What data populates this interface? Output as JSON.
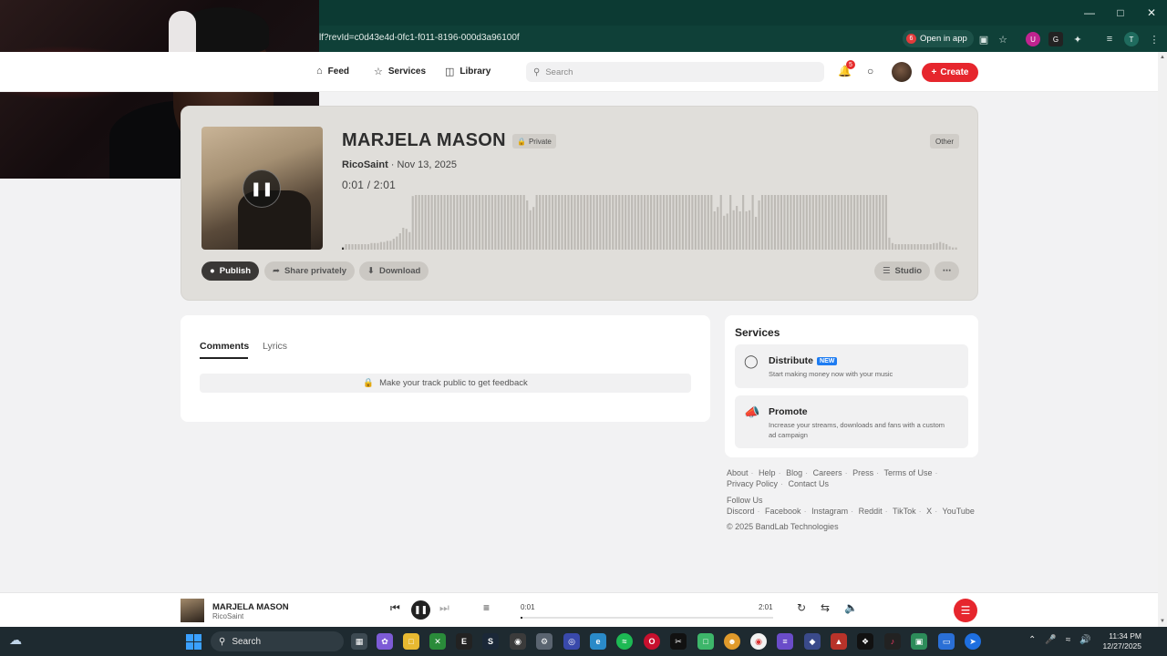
{
  "browser": {
    "url": "lf?revId=c0d43e4d-0fc1-f011-8196-000d3a96100f",
    "open_in_app_label": "Open in app",
    "open_in_app_badge": "6"
  },
  "nav": {
    "items": [
      {
        "label": "Feed",
        "icon": "home-icon"
      },
      {
        "label": "Services",
        "icon": "star-icon"
      },
      {
        "label": "Library",
        "icon": "library-icon"
      }
    ],
    "search_placeholder": "Search",
    "notification_count": "5",
    "create_label": "Create"
  },
  "track": {
    "title": "MARJELA MASON",
    "visibility": "Private",
    "genre": "Other",
    "artist": "RicoSaint",
    "date": "· Nov 13, 2025",
    "current_time": "0:01",
    "duration": "2:01",
    "actions": {
      "publish": "Publish",
      "share": "Share privately",
      "download": "Download",
      "studio": "Studio"
    },
    "waveform_levels": [
      0.04,
      0.1,
      0.1,
      0.1,
      0.1,
      0.1,
      0.1,
      0.1,
      0.1,
      0.12,
      0.12,
      0.12,
      0.14,
      0.14,
      0.16,
      0.16,
      0.2,
      0.24,
      0.3,
      0.4,
      0.38,
      0.32,
      0.98,
      1,
      1,
      1,
      1,
      1,
      1,
      1,
      1,
      1,
      1,
      1,
      1,
      1,
      1,
      1,
      1,
      1,
      1,
      1,
      1,
      1,
      1,
      1,
      1,
      1,
      1,
      1,
      1,
      1,
      1,
      1,
      1,
      1,
      1,
      1,
      0.9,
      0.72,
      0.78,
      1,
      1,
      1,
      1,
      1,
      1,
      1,
      1,
      1,
      1,
      1,
      1,
      1,
      1,
      1,
      1,
      1,
      1,
      1,
      1,
      1,
      1,
      1,
      1,
      1,
      1,
      1,
      1,
      1,
      1,
      1,
      1,
      1,
      1,
      1,
      1,
      1,
      1,
      1,
      1,
      1,
      1,
      1,
      1,
      1,
      1,
      1,
      1,
      1,
      1,
      1,
      1,
      1,
      1,
      1,
      1,
      0.7,
      0.78,
      1,
      0.62,
      0.66,
      1,
      0.72,
      0.8,
      0.7,
      1,
      0.7,
      0.72,
      1,
      0.6,
      0.9,
      1,
      1,
      1,
      1,
      1,
      1,
      1,
      1,
      1,
      1,
      1,
      1,
      1,
      1,
      1,
      1,
      1,
      1,
      1,
      1,
      1,
      1,
      1,
      1,
      1,
      1,
      1,
      1,
      1,
      1,
      1,
      1,
      1,
      1,
      1,
      1,
      1,
      1,
      1,
      1,
      0.22,
      0.12,
      0.1,
      0.1,
      0.1,
      0.1,
      0.1,
      0.1,
      0.1,
      0.1,
      0.1,
      0.1,
      0.1,
      0.1,
      0.12,
      0.12,
      0.14,
      0.12,
      0.1,
      0.06,
      0.04,
      0.04
    ],
    "progress": 0.008
  },
  "comments": {
    "tabs": [
      "Comments",
      "Lyrics"
    ],
    "active_tab": "Comments",
    "note": "Make your track public to get feedback"
  },
  "services": {
    "title": "Services",
    "items": [
      {
        "name": "Distribute",
        "badge": "NEW",
        "desc": "Start making money now with your music",
        "icon": "distribute-icon"
      },
      {
        "name": "Promote",
        "badge": "",
        "desc": "Increase your streams, downloads and fans with a custom ad campaign",
        "icon": "megaphone-icon"
      }
    ]
  },
  "footer": {
    "links_row1": [
      "About",
      "Help",
      "Blog",
      "Careers",
      "Press",
      "Terms of Use"
    ],
    "links_row2": [
      "Privacy Policy",
      "Contact Us"
    ],
    "follow_label": "Follow Us",
    "social": [
      "Discord",
      "Facebook",
      "Instagram",
      "Reddit",
      "TikTok",
      "X",
      "YouTube"
    ],
    "copyright": "© 2025 BandLab Technologies"
  },
  "player": {
    "title": "MARJELA MASON",
    "artist": "RicoSaint",
    "current_time": "0:01",
    "duration": "2:01",
    "progress": 0.008
  },
  "taskbar": {
    "search_label": "Search",
    "time": "11:34 PM",
    "date": "12/27/2025"
  },
  "colors": {
    "accent": "#e6262d",
    "hero_bg": "#e0deda",
    "waveform": "#bdbab5",
    "browser_bar": "#0c3a33"
  }
}
